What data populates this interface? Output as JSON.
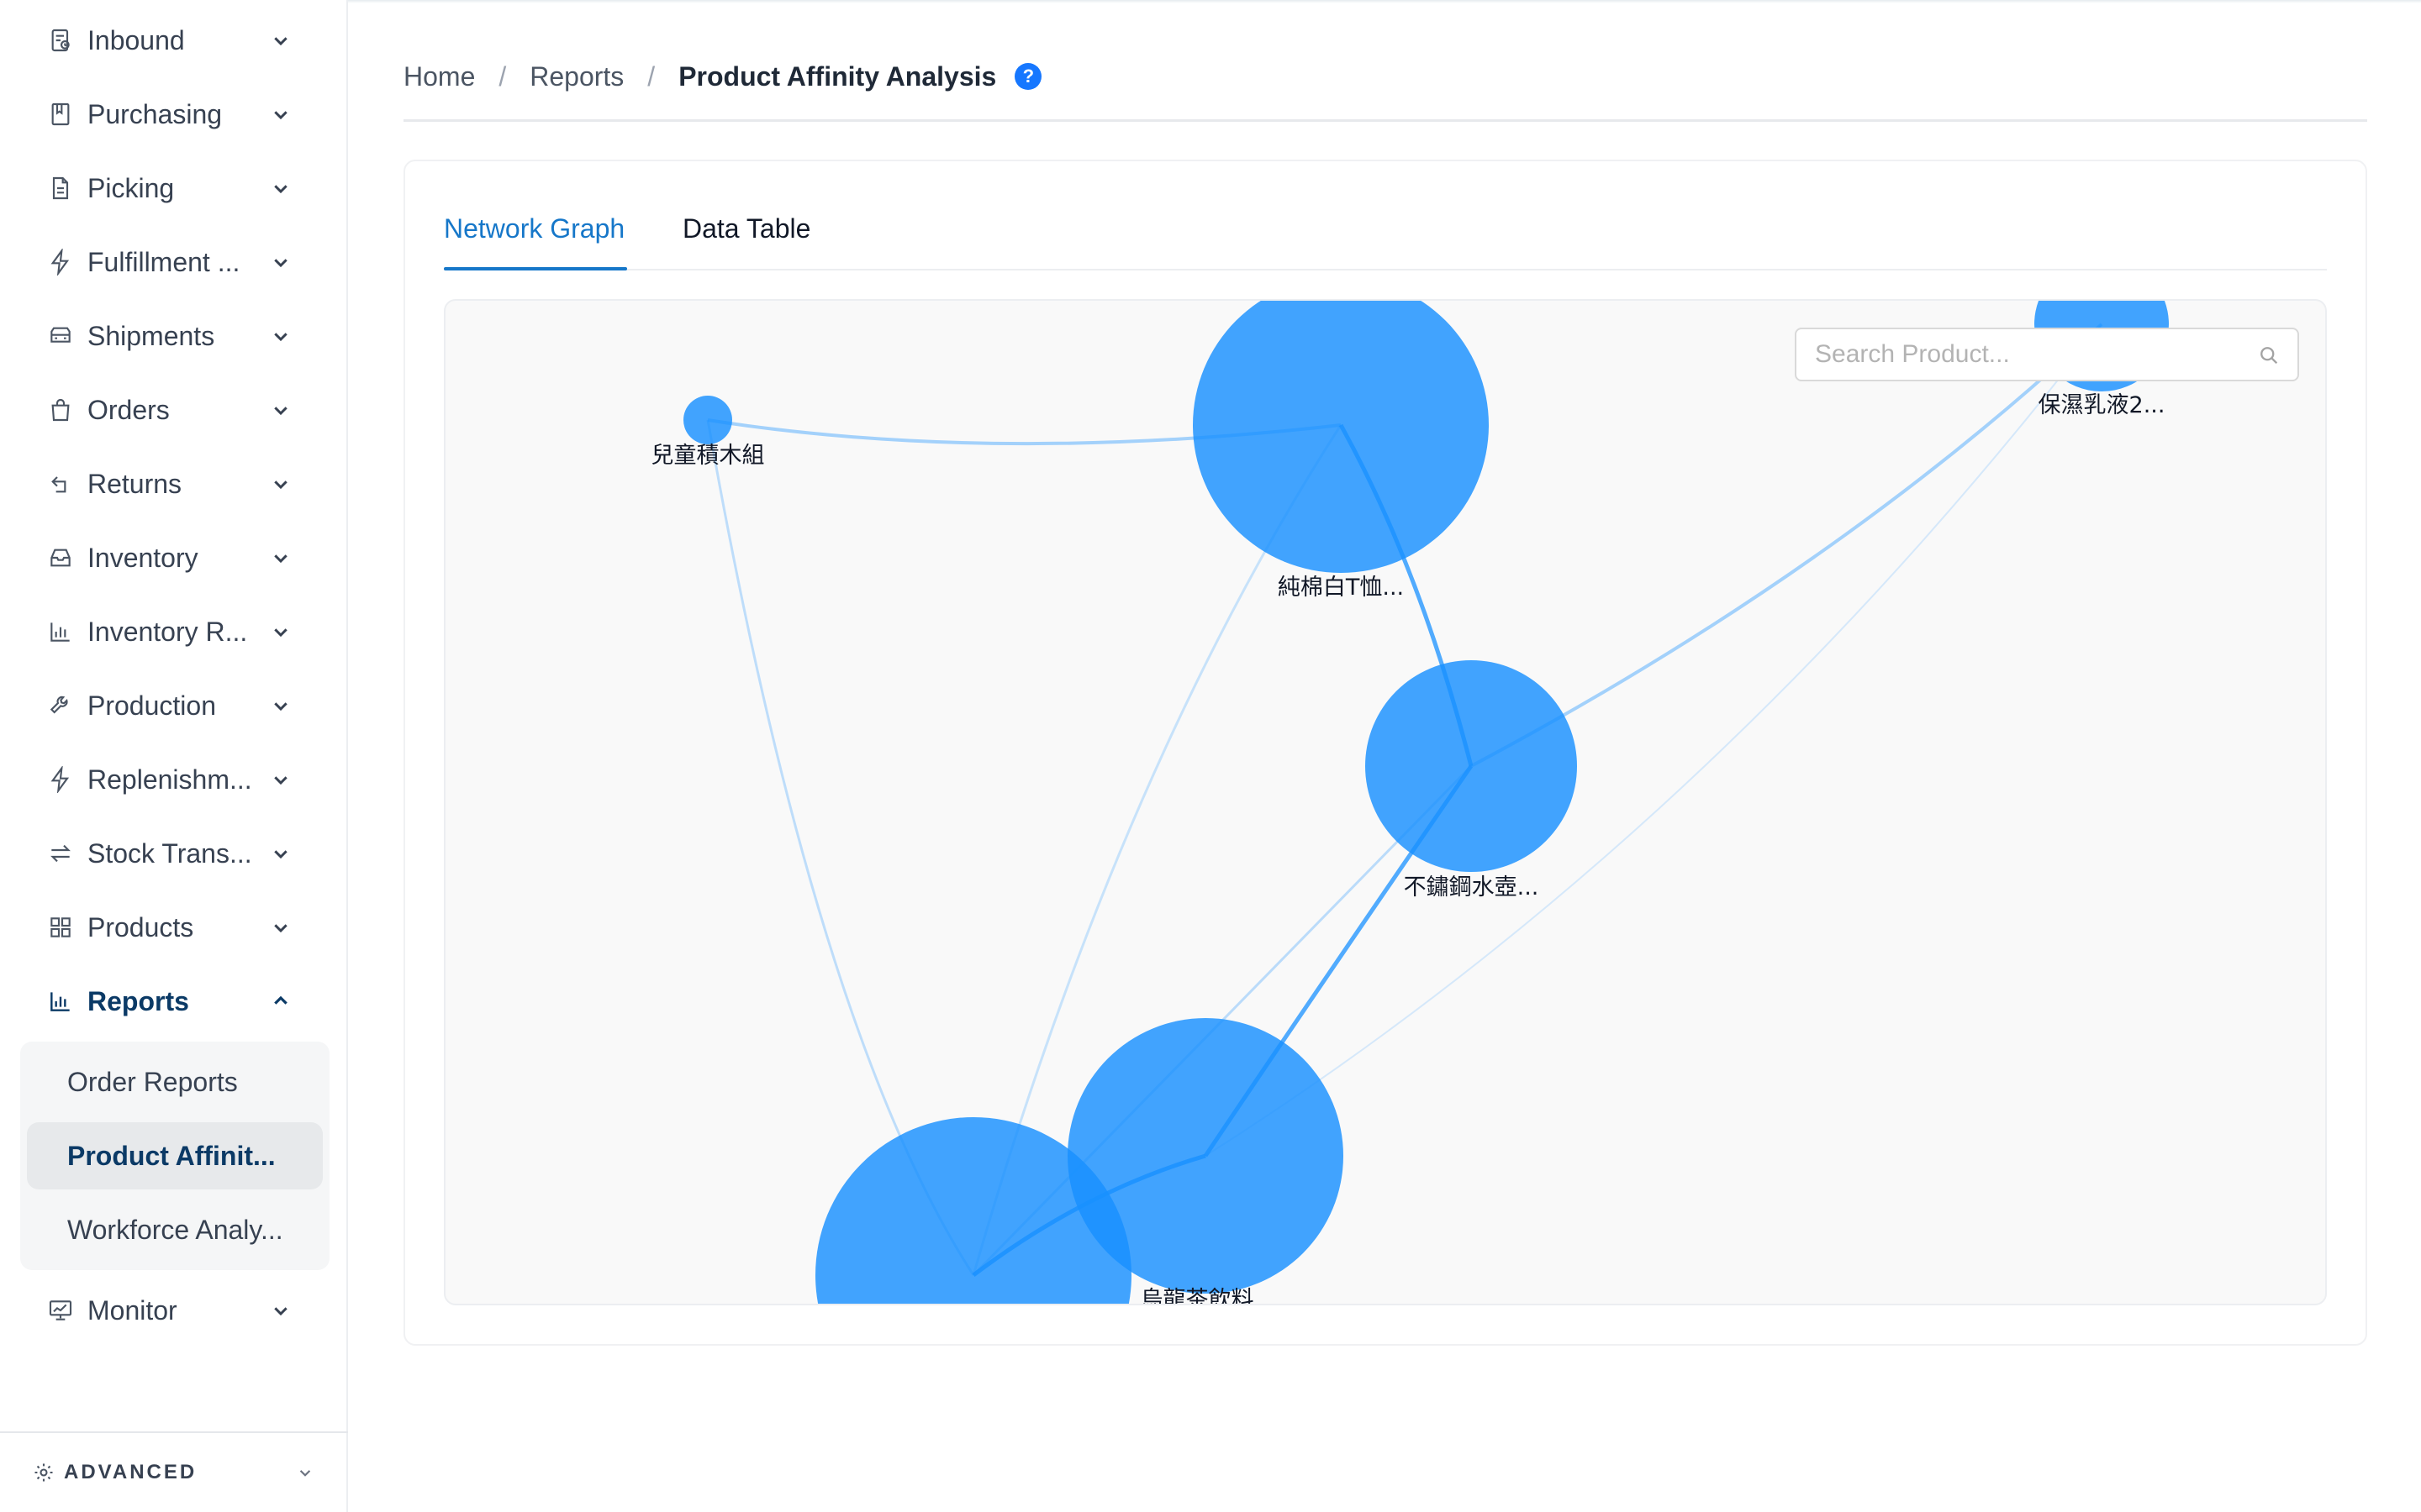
{
  "sidebar": {
    "items": [
      {
        "label": "Inbound",
        "icon": "inbound-icon"
      },
      {
        "label": "Purchasing",
        "icon": "book-icon"
      },
      {
        "label": "Picking",
        "icon": "document-icon"
      },
      {
        "label": "Fulfillment ...",
        "icon": "lightning-icon"
      },
      {
        "label": "Shipments",
        "icon": "truck-icon"
      },
      {
        "label": "Orders",
        "icon": "shopping-bag-icon"
      },
      {
        "label": "Returns",
        "icon": "return-arrow-icon"
      },
      {
        "label": "Inventory",
        "icon": "inbox-icon"
      },
      {
        "label": "Inventory R...",
        "icon": "bar-chart-icon"
      },
      {
        "label": "Production",
        "icon": "wrench-icon"
      },
      {
        "label": "Replenishm...",
        "icon": "lightning-icon"
      },
      {
        "label": "Stock Trans...",
        "icon": "swap-icon"
      },
      {
        "label": "Products",
        "icon": "grid-icon"
      },
      {
        "label": "Reports",
        "icon": "bar-chart-icon"
      },
      {
        "label": "Monitor",
        "icon": "monitor-chart-icon"
      }
    ],
    "reports_submenu": [
      {
        "label": "Order Reports"
      },
      {
        "label": "Product Affinit..."
      },
      {
        "label": "Workforce Analy..."
      }
    ],
    "advanced_label": "ADVANCED"
  },
  "breadcrumb": {
    "home": "Home",
    "reports": "Reports",
    "current": "Product Affinity Analysis",
    "help": "?"
  },
  "tabs": [
    {
      "label": "Network Graph",
      "active": true
    },
    {
      "label": "Data Table",
      "active": false
    }
  ],
  "search": {
    "placeholder": "Search Product..."
  },
  "graph": {
    "node_color": "#1890ff",
    "nodes": [
      {
        "id": "blocks",
        "label": "兒童積木組"
      },
      {
        "id": "tshirt",
        "label": "純棉白T恤..."
      },
      {
        "id": "lotion",
        "label": "保濕乳液2..."
      },
      {
        "id": "bottle",
        "label": "不鏽鋼水壺..."
      },
      {
        "id": "tea",
        "label": "烏龍茶飲料"
      },
      {
        "id": "bottom",
        "label": ""
      }
    ],
    "edges": [
      {
        "from": "blocks",
        "to": "tshirt"
      },
      {
        "from": "blocks",
        "to": "bottom"
      },
      {
        "from": "tshirt",
        "to": "bottle"
      },
      {
        "from": "tshirt",
        "to": "bottom"
      },
      {
        "from": "bottle",
        "to": "lotion"
      },
      {
        "from": "bottle",
        "to": "tea"
      },
      {
        "from": "bottle",
        "to": "bottom"
      },
      {
        "from": "tea",
        "to": "bottom"
      },
      {
        "from": "tea",
        "to": "lotion"
      }
    ]
  },
  "colors": {
    "accent": "#1677c9",
    "active_nav": "#0b3a66",
    "help_badge": "#1677ff"
  }
}
